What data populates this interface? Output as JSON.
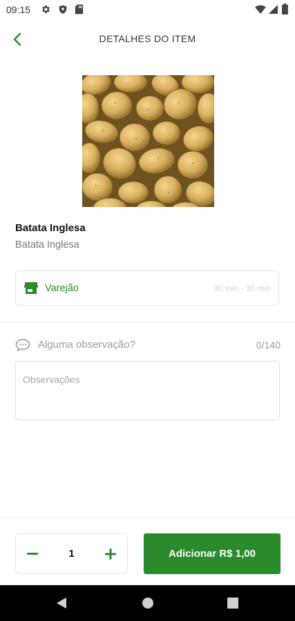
{
  "status_bar": {
    "time": "09:15",
    "icons": [
      "gear-icon",
      "shield-icon",
      "sd-card-icon",
      "wifi-icon",
      "signal-icon",
      "battery-icon"
    ]
  },
  "header": {
    "title": "DETALHES DO ITEM",
    "back_icon": "chevron-left-icon"
  },
  "product": {
    "image": "potatoes-photo",
    "name": "Batata Inglesa",
    "description": "Batata Inglesa"
  },
  "store": {
    "icon": "storefront-icon",
    "name": "Varejão",
    "delivery_time": "30 min - 30 min"
  },
  "observation": {
    "icon": "chat-bubble-icon",
    "label": "Alguma observação?",
    "counter": "0/140",
    "placeholder": "Observações",
    "value": ""
  },
  "cart": {
    "quantity": "1",
    "add_label": "Adicionar R$ 1,00",
    "decrement_icon": "minus-icon",
    "increment_icon": "plus-icon"
  },
  "nav_bar": {
    "icons": [
      "back-triangle-icon",
      "home-circle-icon",
      "recents-square-icon"
    ]
  },
  "colors": {
    "accent": "#2b8a2b",
    "nav_bar": "#000000",
    "border": "#e6e6e6"
  }
}
